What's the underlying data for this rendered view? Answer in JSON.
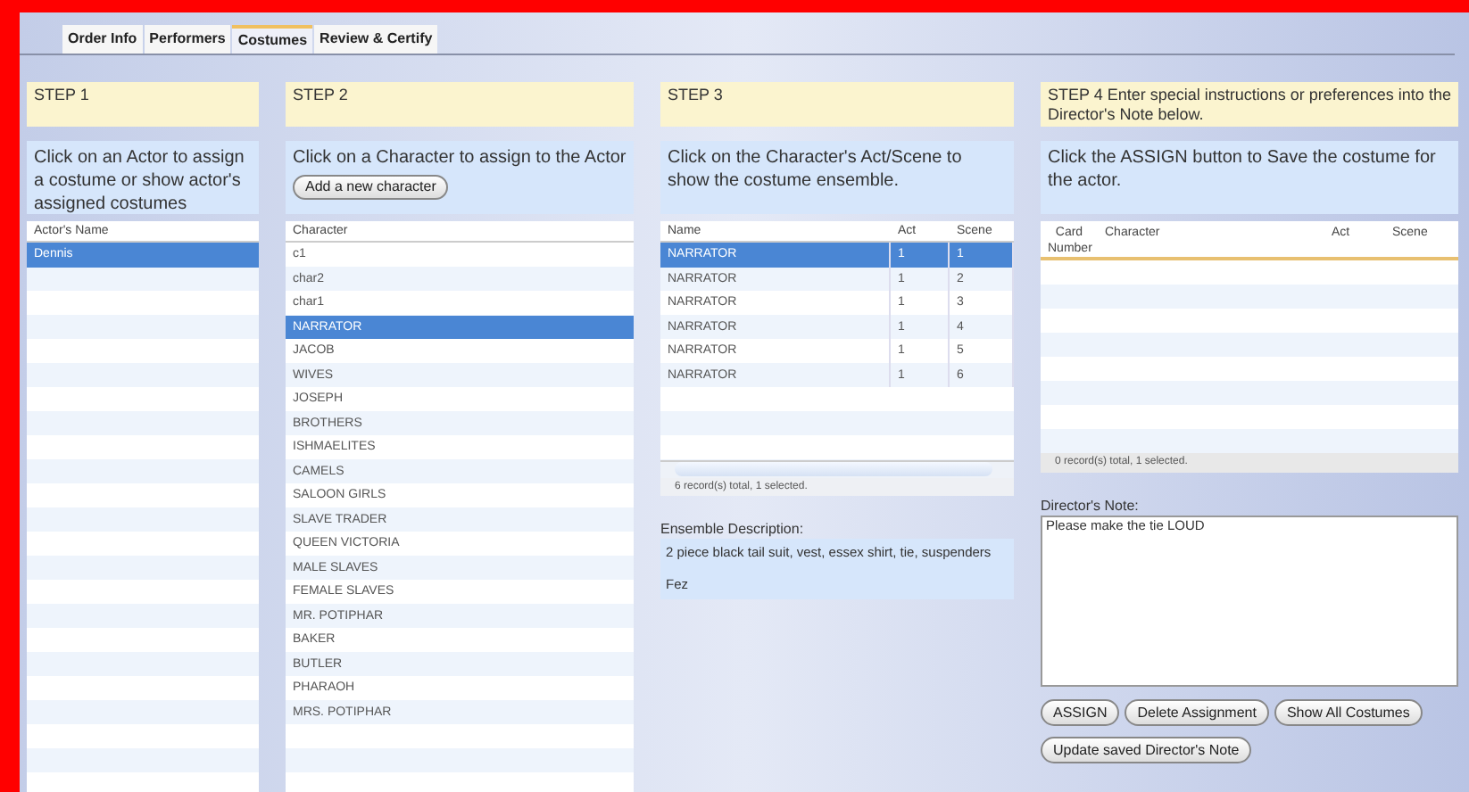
{
  "tabs": [
    {
      "label": "Order Info",
      "selected": false
    },
    {
      "label": "Performers",
      "selected": false
    },
    {
      "label": "Costumes",
      "selected": true
    },
    {
      "label": "Review & Certify",
      "selected": false
    }
  ],
  "step1": {
    "heading": "STEP 1",
    "instruction": "Click on an Actor to assign a costume or show actor's assigned costumes",
    "column": "Actor's Name",
    "rows": [
      {
        "name": "Dennis",
        "selected": true
      }
    ]
  },
  "step2": {
    "heading": "STEP 2",
    "instruction": "Click on a Character to assign to the Actor",
    "add_button": "Add a new character",
    "column": "Character",
    "rows": [
      {
        "name": "c1",
        "selected": false
      },
      {
        "name": "char2",
        "selected": false
      },
      {
        "name": "char1",
        "selected": false
      },
      {
        "name": "NARRATOR",
        "selected": true
      },
      {
        "name": "JACOB",
        "selected": false
      },
      {
        "name": "WIVES",
        "selected": false
      },
      {
        "name": "JOSEPH",
        "selected": false
      },
      {
        "name": "BROTHERS",
        "selected": false
      },
      {
        "name": "ISHMAELITES",
        "selected": false
      },
      {
        "name": "CAMELS",
        "selected": false
      },
      {
        "name": "SALOON GIRLS",
        "selected": false
      },
      {
        "name": "SLAVE TRADER",
        "selected": false
      },
      {
        "name": "QUEEN VICTORIA",
        "selected": false
      },
      {
        "name": "MALE SLAVES",
        "selected": false
      },
      {
        "name": "FEMALE SLAVES",
        "selected": false
      },
      {
        "name": "MR. POTIPHAR",
        "selected": false
      },
      {
        "name": "BAKER",
        "selected": false
      },
      {
        "name": "BUTLER",
        "selected": false
      },
      {
        "name": "PHARAOH",
        "selected": false
      },
      {
        "name": "MRS. POTIPHAR",
        "selected": false
      }
    ]
  },
  "step3": {
    "heading": "STEP 3",
    "instruction": "Click on the Character's Act/Scene to show the costume ensemble.",
    "columns": [
      "Name",
      "Act",
      "Scene"
    ],
    "rows": [
      {
        "cells": [
          "NARRATOR",
          "1",
          "1"
        ],
        "selected": true
      },
      {
        "cells": [
          "NARRATOR",
          "1",
          "2"
        ],
        "selected": false
      },
      {
        "cells": [
          "NARRATOR",
          "1",
          "3"
        ],
        "selected": false
      },
      {
        "cells": [
          "NARRATOR",
          "1",
          "4"
        ],
        "selected": false
      },
      {
        "cells": [
          "NARRATOR",
          "1",
          "5"
        ],
        "selected": false
      },
      {
        "cells": [
          "NARRATOR",
          "1",
          "6"
        ],
        "selected": false
      }
    ],
    "status": "6 record(s) total, 1 selected.",
    "ensemble_label": "Ensemble Description:",
    "ensemble_lines": [
      "2 piece black tail suit, vest, essex shirt, tie, suspenders",
      "Fez"
    ]
  },
  "step4": {
    "heading": "STEP 4 Enter special instructions or preferences into the Director's Note below.",
    "instruction": "Click the ASSIGN button to Save the costume for the actor.",
    "columns": [
      "Card Number",
      "Character",
      "Act",
      "Scene"
    ],
    "status": "0 record(s) total, 1 selected.",
    "note_label": "Director's Note:",
    "note_value": "Please make the tie LOUD",
    "buttons": [
      "ASSIGN",
      "Delete Assignment",
      "Show All Costumes",
      "Update saved Director's Note"
    ]
  }
}
